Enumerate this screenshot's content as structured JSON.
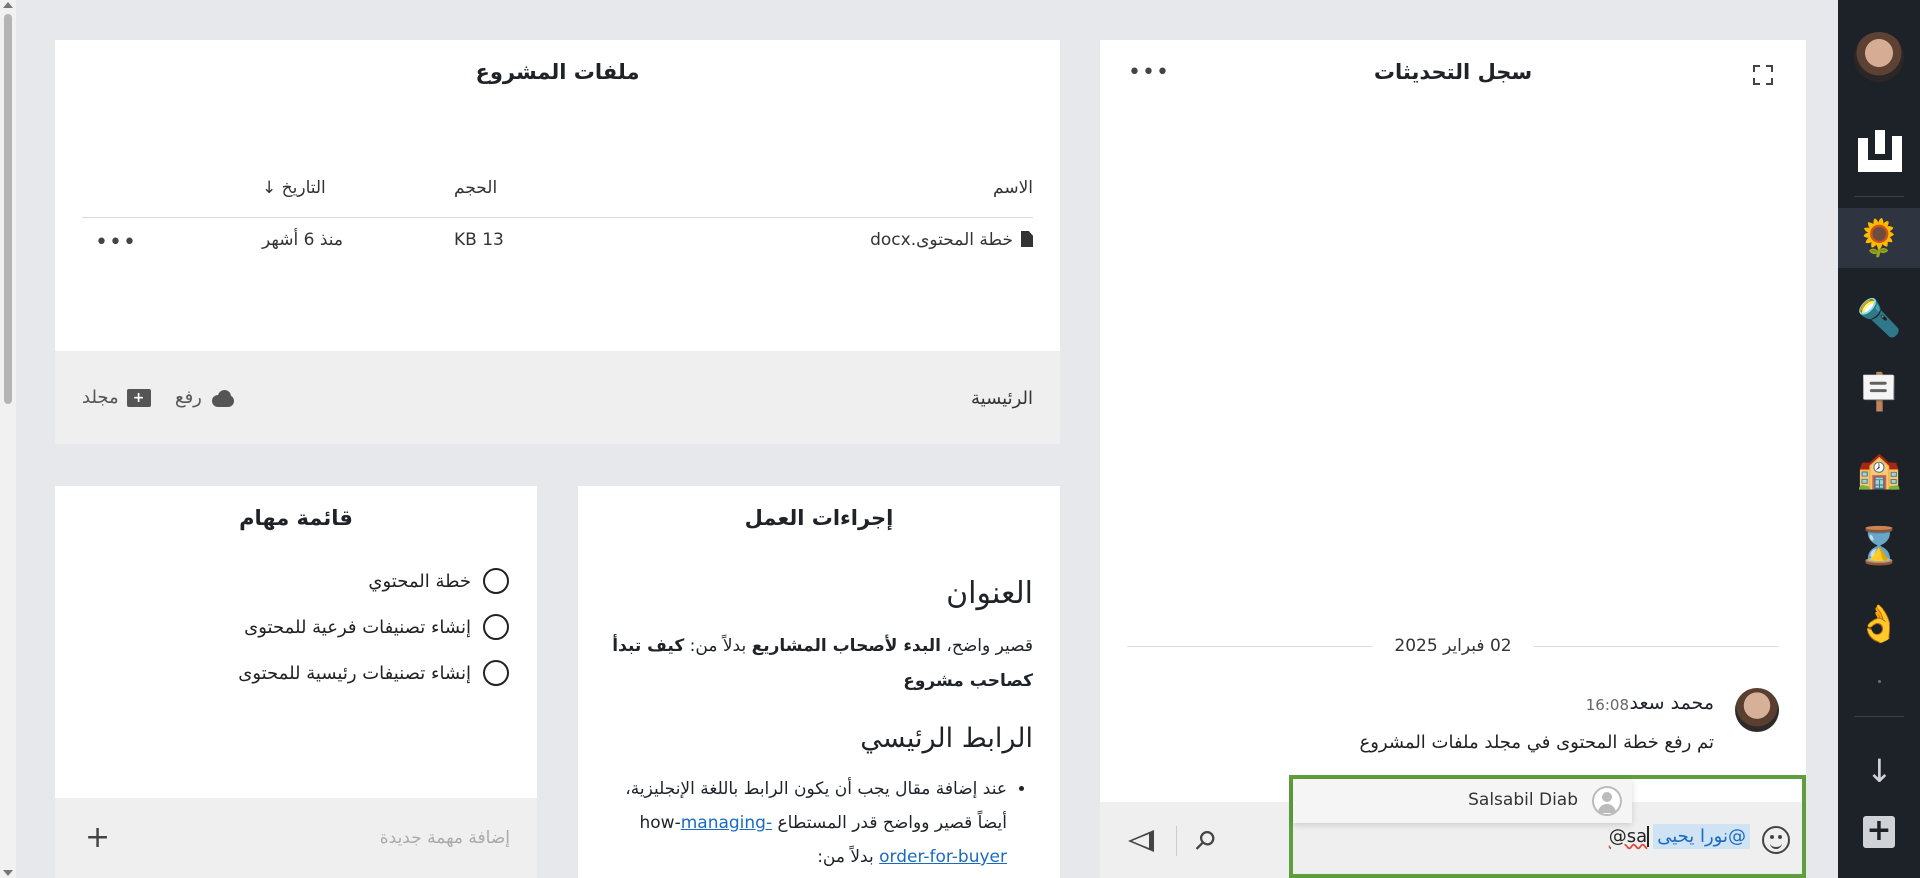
{
  "files_panel": {
    "title": "ملفات المشروع",
    "columns": {
      "name": "الاسم",
      "size": "الحجم",
      "date": "التاريخ ↓"
    },
    "rows": [
      {
        "name": "خطة المحتوى.docx",
        "size": "13 KB",
        "date": "منذ 6 أشهر"
      }
    ],
    "footer": {
      "home": "الرئيسية",
      "upload": "رفع",
      "folder": "مجلد"
    }
  },
  "updates_panel": {
    "title": "سجل التحديثات",
    "date_separator": "02 فبراير 2025",
    "message": {
      "author": "محمد سعد",
      "time": "16:08",
      "text": "تم رفع خطة المحتوى في مجلد ملفات المشروع"
    },
    "composer": {
      "mention": "@نورا يحيى",
      "typed": "sa@"
    },
    "mention_suggestion": "Salsabil Diab"
  },
  "procedure_panel": {
    "title": "إجراءات العمل",
    "heading1": "العنوان",
    "para_start": "قصير واضح، ",
    "para_bold1": "البدء لأصحاب المشاريع",
    "para_mid": " بدلاً من: ",
    "para_bold2": "كيف تبدأ كصاحب مشروع",
    "heading2": "الرابط الرئيسي",
    "bullet_text": "عند إضافة مقال يجب أن يكون الرابط باللغة الإنجليزية، أيضاً قصير وواضح قدر المستطاع how-",
    "bullet_mid": " بدلاً من: ",
    "bullet_link": "managing-order-for-buyer"
  },
  "tasks_panel": {
    "title": "قائمة مهام",
    "tasks": [
      "خطة المحتوي",
      "إنشاء تصنيفات فرعية للمحتوى",
      "إنشاء تصنيفات رئيسية للمحتوى"
    ],
    "new_task_placeholder": "إضافة مهمة جديدة"
  },
  "sidebar": {
    "items": [
      {
        "icon": "sunflower-icon",
        "glyph": "🌻"
      },
      {
        "icon": "flashlight-icon",
        "glyph": "🔦"
      },
      {
        "icon": "presentation-icon",
        "glyph": "🪧"
      },
      {
        "icon": "school-icon",
        "glyph": "🏫"
      },
      {
        "icon": "hourglass-icon",
        "glyph": "⌛"
      },
      {
        "icon": "ok-hand-icon",
        "glyph": "👌"
      }
    ]
  },
  "colors": {
    "focus_border": "#5e9e3c",
    "sidebar_bg": "#1d2128",
    "mention_bg": "#cfe3f5"
  }
}
